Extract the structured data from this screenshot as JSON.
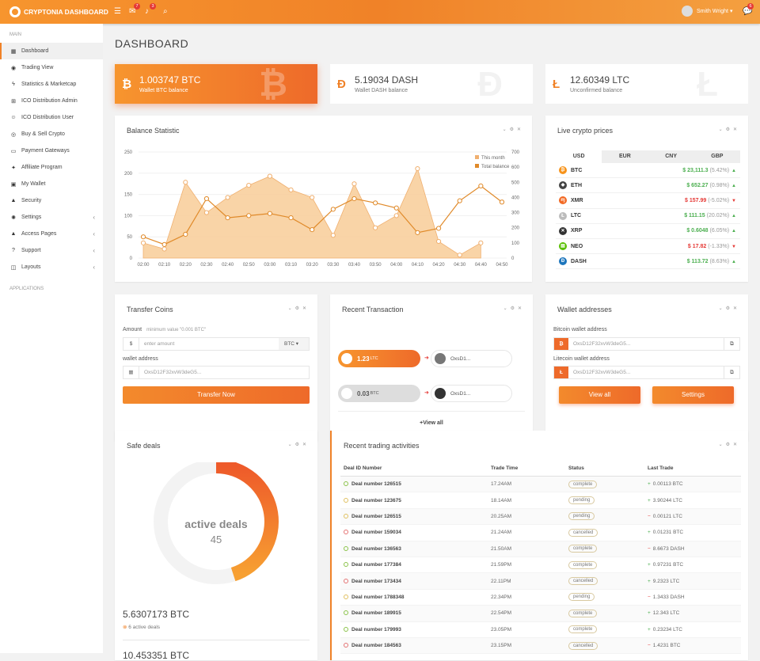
{
  "app": {
    "title": "CRYPTONIA DASHBOARD",
    "user": "Smith Wright",
    "badges": {
      "mail": "7",
      "bell": "3",
      "chat": "6"
    }
  },
  "sidebar": {
    "section_main": "MAIN",
    "section_apps": "APPLICATIONS",
    "items": [
      {
        "label": "Dashboard",
        "icon": "grid-icon",
        "active": true
      },
      {
        "label": "Trading View",
        "icon": "eye-icon"
      },
      {
        "label": "Statistics & Marketcap",
        "icon": "bolt-icon"
      },
      {
        "label": "ICO Distribution Admin",
        "icon": "sitemap-icon"
      },
      {
        "label": "ICO Distribution User",
        "icon": "user-icon"
      },
      {
        "label": "Buy & Sell Crypto",
        "icon": "coins-icon"
      },
      {
        "label": "Payment Gateways",
        "icon": "card-icon"
      },
      {
        "label": "Affiliate Program",
        "icon": "star-icon"
      },
      {
        "label": "My Wallet",
        "icon": "wallet-icon"
      },
      {
        "label": "Security",
        "icon": "lock-icon"
      },
      {
        "label": "Settings",
        "icon": "gear-icon",
        "chevron": true
      },
      {
        "label": "Access Pages",
        "icon": "lock-icon",
        "chevron": true
      },
      {
        "label": "Support",
        "icon": "help-icon",
        "chevron": true
      },
      {
        "label": "Layouts",
        "icon": "layout-icon",
        "chevron": true
      }
    ]
  },
  "page": {
    "title": "DASHBOARD"
  },
  "wallets": [
    {
      "value": "1.003747 BTC",
      "label": "Wallet BTC balance",
      "icon": "bitcoin-icon"
    },
    {
      "value": "5.19034 DASH",
      "label": "Wallet DASH balance",
      "icon": "dash-icon"
    },
    {
      "value": "12.60349 LTC",
      "label": "Unconfirmed balance",
      "icon": "litecoin-icon"
    }
  ],
  "balance_chart": {
    "title": "Balance Statistic"
  },
  "chart_data": {
    "type": "line",
    "x": [
      "02:00",
      "02:10",
      "02:20",
      "02:30",
      "02:40",
      "02:50",
      "03:00",
      "03:10",
      "03:20",
      "03:30",
      "03:40",
      "03:50",
      "04:00",
      "04:10",
      "04:20",
      "04:30",
      "04:40",
      "04:50"
    ],
    "series": [
      {
        "name": "This month",
        "type": "line",
        "axis": "left",
        "values": [
          50,
          32,
          56,
          140,
          95,
          100,
          105,
          95,
          67,
          115,
          140,
          130,
          118,
          60,
          70,
          135,
          170,
          132
        ]
      },
      {
        "name": "Total balance",
        "type": "area",
        "axis": "right",
        "values": [
          100,
          60,
          500,
          300,
          400,
          480,
          540,
          450,
          400,
          150,
          490,
          200,
          280,
          590,
          110,
          20,
          100
        ]
      }
    ],
    "y_left": {
      "ticks": [
        0,
        50,
        100,
        150,
        200,
        250
      ],
      "lim": [
        0,
        250
      ]
    },
    "y_right": {
      "ticks": [
        0,
        100,
        200,
        300,
        400,
        500,
        600,
        700
      ],
      "lim": [
        0,
        700
      ]
    }
  },
  "prices": {
    "title": "Live crypto prices",
    "tabs": [
      "USD",
      "EUR",
      "CNY",
      "GBP"
    ],
    "rows": [
      {
        "sym": "BTC",
        "price": "$ 23,111.3",
        "pct": "(5.42%)",
        "dir": "up",
        "color": "#f7931a",
        "icon": "bitcoin-icon"
      },
      {
        "sym": "ETH",
        "price": "$ 652.27",
        "pct": "(0.98%)",
        "dir": "up",
        "color": "#444",
        "icon": "ethereum-icon"
      },
      {
        "sym": "XMR",
        "price": "$ 157.99",
        "pct": "(-5.02%)",
        "dir": "dn",
        "color": "#f26822",
        "icon": "monero-icon"
      },
      {
        "sym": "LTC",
        "price": "$ 111.15",
        "pct": "(20.02%)",
        "dir": "up",
        "color": "#bbb",
        "icon": "litecoin-icon"
      },
      {
        "sym": "XRP",
        "price": "$ 0.6048",
        "pct": "(6.05%)",
        "dir": "up",
        "color": "#333",
        "icon": "ripple-icon"
      },
      {
        "sym": "NEO",
        "price": "$ 17.82",
        "pct": "(-1.33%)",
        "dir": "dn",
        "color": "#58bf00",
        "icon": "neo-icon"
      },
      {
        "sym": "DASH",
        "price": "$ 113.72",
        "pct": "(8.63%)",
        "dir": "up",
        "color": "#1c75bc",
        "icon": "dash-icon"
      }
    ]
  },
  "transfer": {
    "title": "Transfer Coins",
    "amount_label": "Amount",
    "min_value": "minimum value \"0.001 BTC\"",
    "currency_symbol": "$",
    "amount_placeholder": "enter amount",
    "currency": "BTC",
    "wallet_label": "wallet address",
    "wallet_value": "OxsD12F32xvW3deG5...",
    "button": "Transfer Now"
  },
  "recent_tx": {
    "title": "Recent Transaction",
    "items": [
      {
        "amount": "1.23",
        "unit": "LTC",
        "to": "OxsD1..."
      },
      {
        "amount": "0.03",
        "unit": "BTC",
        "to": "OxsD1..."
      }
    ],
    "view_all": "View all"
  },
  "addresses": {
    "title": "Wallet addresses",
    "btc_label": "Bitcoin wallet address",
    "btc_value": "OxsD12F32xvW3deG5...",
    "ltc_label": "Litecoin wallet address",
    "ltc_value": "OxsD12F32xvW3deG5...",
    "view_all": "View all",
    "settings": "Settings"
  },
  "safe_deals": {
    "title": "Safe deals",
    "donut_label": "active deals",
    "donut_value": "45",
    "donut_fraction": 0.45,
    "btc": "5.6307173 BTC",
    "active": "6 active deals",
    "btc2": "10.453351 BTC"
  },
  "trading": {
    "title": "Recent trading activities",
    "headers": [
      "Deal ID Number",
      "Trade Time",
      "Status",
      "Last Trade"
    ],
    "rows": [
      {
        "id": "Deal number 126515",
        "time": "17.24AM",
        "status": "complete",
        "trade": "0.00113 BTC",
        "dir": "up"
      },
      {
        "id": "Deal number 123675",
        "time": "18.14AM",
        "status": "pending",
        "trade": "3.90244 LTC",
        "dir": "up"
      },
      {
        "id": "Deal number 126515",
        "time": "20.25AM",
        "status": "pending",
        "trade": "0.00121 LTC",
        "dir": "dn"
      },
      {
        "id": "Deal number 159034",
        "time": "21.24AM",
        "status": "cancelled",
        "trade": "0.01231 BTC",
        "dir": "up"
      },
      {
        "id": "Deal number 136563",
        "time": "21.50AM",
        "status": "complete",
        "trade": "8.6673 DASH",
        "dir": "dn"
      },
      {
        "id": "Deal number 177384",
        "time": "21.59PM",
        "status": "complete",
        "trade": "0.97231 BTC",
        "dir": "up"
      },
      {
        "id": "Deal number 173434",
        "time": "22.11PM",
        "status": "cancelled",
        "trade": "9.2323 LTC",
        "dir": "up"
      },
      {
        "id": "Deal number 1788348",
        "time": "22.34PM",
        "status": "pending",
        "trade": "1.3433 DASH",
        "dir": "dn"
      },
      {
        "id": "Deal number 189915",
        "time": "22.54PM",
        "status": "complete",
        "trade": "12.343 LTC",
        "dir": "up"
      },
      {
        "id": "Deal number 179993",
        "time": "23.05PM",
        "status": "complete",
        "trade": "0.23234 LTC",
        "dir": "up"
      },
      {
        "id": "Deal number 184563",
        "time": "23.15PM",
        "status": "cancelled",
        "trade": "1.4231 BTC",
        "dir": "dn"
      }
    ]
  }
}
